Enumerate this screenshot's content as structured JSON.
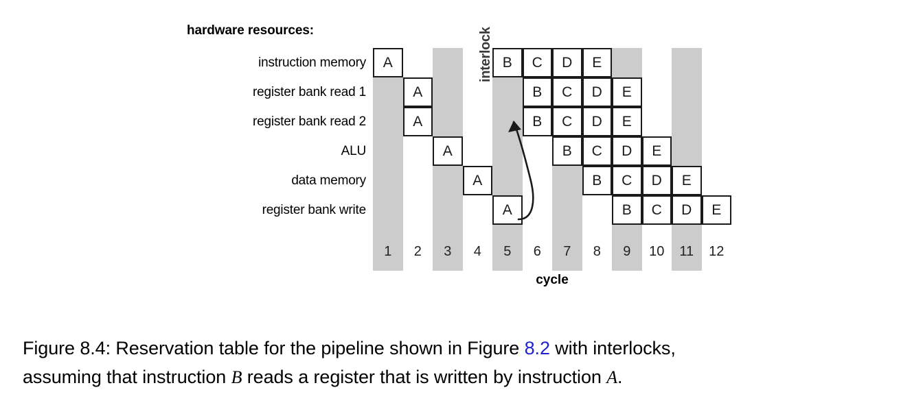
{
  "figure": {
    "hardware_resources_title": "hardware resources:",
    "cycle_axis_label": "cycle",
    "interlock_label": "interlock",
    "stripe_color": "#cccccc",
    "cell_border_color": "#1a1a1a",
    "rows": [
      {
        "label": "instruction memory",
        "cells": [
          {
            "cycle": 1,
            "text": "A"
          },
          {
            "cycle": 5,
            "text": "B"
          },
          {
            "cycle": 6,
            "text": "C"
          },
          {
            "cycle": 7,
            "text": "D"
          },
          {
            "cycle": 8,
            "text": "E"
          }
        ]
      },
      {
        "label": "register bank read 1",
        "cells": [
          {
            "cycle": 2,
            "text": "A"
          },
          {
            "cycle": 6,
            "text": "B"
          },
          {
            "cycle": 7,
            "text": "C"
          },
          {
            "cycle": 8,
            "text": "D"
          },
          {
            "cycle": 9,
            "text": "E"
          }
        ]
      },
      {
        "label": "register bank read 2",
        "cells": [
          {
            "cycle": 2,
            "text": "A"
          },
          {
            "cycle": 6,
            "text": "B"
          },
          {
            "cycle": 7,
            "text": "C"
          },
          {
            "cycle": 8,
            "text": "D"
          },
          {
            "cycle": 9,
            "text": "E"
          }
        ]
      },
      {
        "label": "ALU",
        "cells": [
          {
            "cycle": 3,
            "text": "A"
          },
          {
            "cycle": 7,
            "text": "B"
          },
          {
            "cycle": 8,
            "text": "C"
          },
          {
            "cycle": 9,
            "text": "D"
          },
          {
            "cycle": 10,
            "text": "E"
          }
        ]
      },
      {
        "label": "data memory",
        "cells": [
          {
            "cycle": 4,
            "text": "A"
          },
          {
            "cycle": 8,
            "text": "B"
          },
          {
            "cycle": 9,
            "text": "C"
          },
          {
            "cycle": 10,
            "text": "D"
          },
          {
            "cycle": 11,
            "text": "E"
          }
        ]
      },
      {
        "label": "register bank write",
        "cells": [
          {
            "cycle": 5,
            "text": "A"
          },
          {
            "cycle": 9,
            "text": "B"
          },
          {
            "cycle": 10,
            "text": "C"
          },
          {
            "cycle": 11,
            "text": "D"
          },
          {
            "cycle": 12,
            "text": "E"
          }
        ]
      }
    ],
    "cycles": [
      "1",
      "2",
      "3",
      "4",
      "5",
      "6",
      "7",
      "8",
      "9",
      "10",
      "11",
      "12"
    ],
    "shaded_cycles": [
      1,
      3,
      5,
      7,
      9,
      11
    ]
  },
  "caption": {
    "line1_part1": "Figure 8.4: Reservation table for the pipeline shown in Figure ",
    "line1_xref": "8.2",
    "line1_part2": " with interlocks,",
    "line2_part1": "assuming that instruction ",
    "line2_math1": "B",
    "line2_part2": " reads a register that is written by instruction ",
    "line2_math2": "A",
    "line2_part3": "."
  }
}
